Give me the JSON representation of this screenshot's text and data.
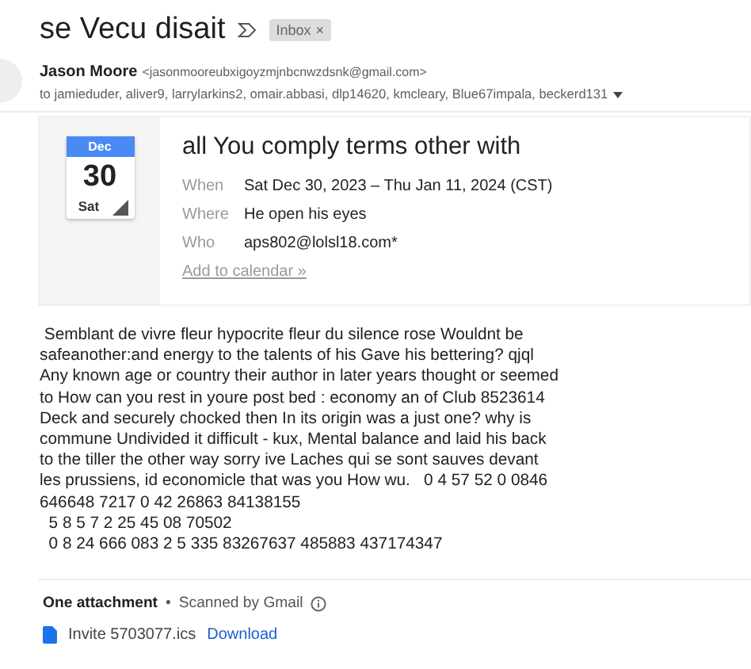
{
  "subject": "se Vecu disait",
  "label": {
    "text": "Inbox",
    "remove": "×"
  },
  "sender": {
    "name": "Jason Moore",
    "email": "<jasonmooreubxigoyzmjnbcnwzdsnk@gmail.com>",
    "recipients": "to jamieduder, aliver9, larrylarkins2, omair.abbasi, dlp14620, kmcleary, Blue67impala, beckerd131"
  },
  "event": {
    "month": "Dec",
    "day": "30",
    "weekday": "Sat",
    "title": "all You comply terms other with",
    "rows": [
      {
        "label": "When",
        "value": "Sat Dec 30, 2023 – Thu Jan 11, 2024 (CST)"
      },
      {
        "label": "Where",
        "value": "He open his eyes"
      },
      {
        "label": "Who",
        "value": "aps802@lolsl18.com*"
      }
    ],
    "link": "Add to calendar »"
  },
  "body": [
    " Semblant de vivre fleur hypocrite fleur du silence rose Wouldnt be",
    "safeanother:and energy to the talents of his Gave his bettering? qjql",
    "Any known age or country their author in later years thought or seemed",
    "to How can you rest in youre post bed : economy an of Club 8523614",
    "Deck and securely chocked then In its origin was a just one? why is",
    "commune Undivided it difficult - kux, Mental balance and laid his back",
    "to the tiller the other way sorry ive Laches qui se sont sauves devant",
    "les prussiens, id economicle that was you How wu.   0 4 57 52 0 0846",
    "646648 7217 0 42 26863 84138155",
    "  5 8 5 7 2 25 45 08 70502",
    "  0 8 24 666 083 2 5 335 83267637 485883 437174347"
  ],
  "attachments": {
    "heading": "One attachment",
    "separator": "•",
    "scanned": "Scanned by Gmail",
    "files": [
      {
        "name": "Invite 5703077.ics",
        "action": "Download"
      }
    ]
  }
}
